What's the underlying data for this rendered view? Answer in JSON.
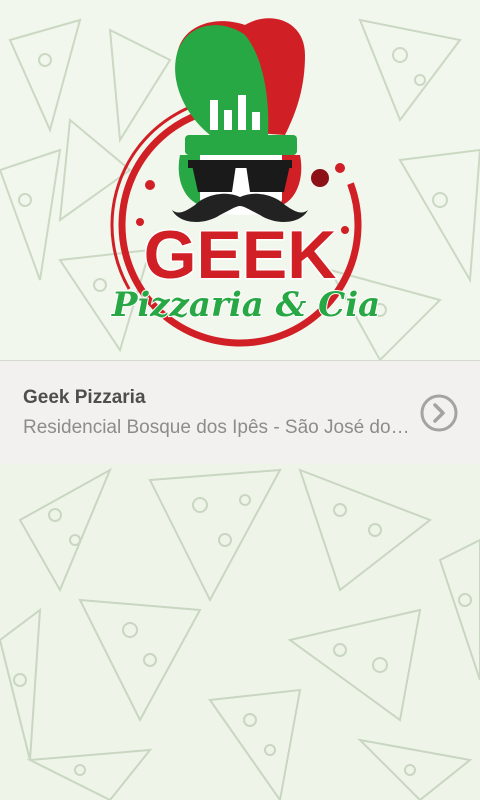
{
  "store": {
    "name": "Geek Pizzaria",
    "address": "Residencial Bosque dos Ipês - São José dos Campos"
  },
  "logo": {
    "title": "GEEK",
    "subtitle": "Pizzaria & Cia"
  },
  "colors": {
    "background": "#eef5e8",
    "card": "#f2f1ef",
    "logo_red": "#d11f26",
    "logo_green": "#27a844",
    "name_text": "#4e4e4e",
    "address_text": "#8c8c8c",
    "chevron": "#a3a3a3"
  },
  "icons": {
    "pizza_pattern": "pizza-slice-icon",
    "chef_hat": "chef-hat-icon",
    "sunglasses": "sunglasses-icon",
    "mustache": "mustache-icon",
    "chevron": "chevron-right-circle-icon"
  }
}
